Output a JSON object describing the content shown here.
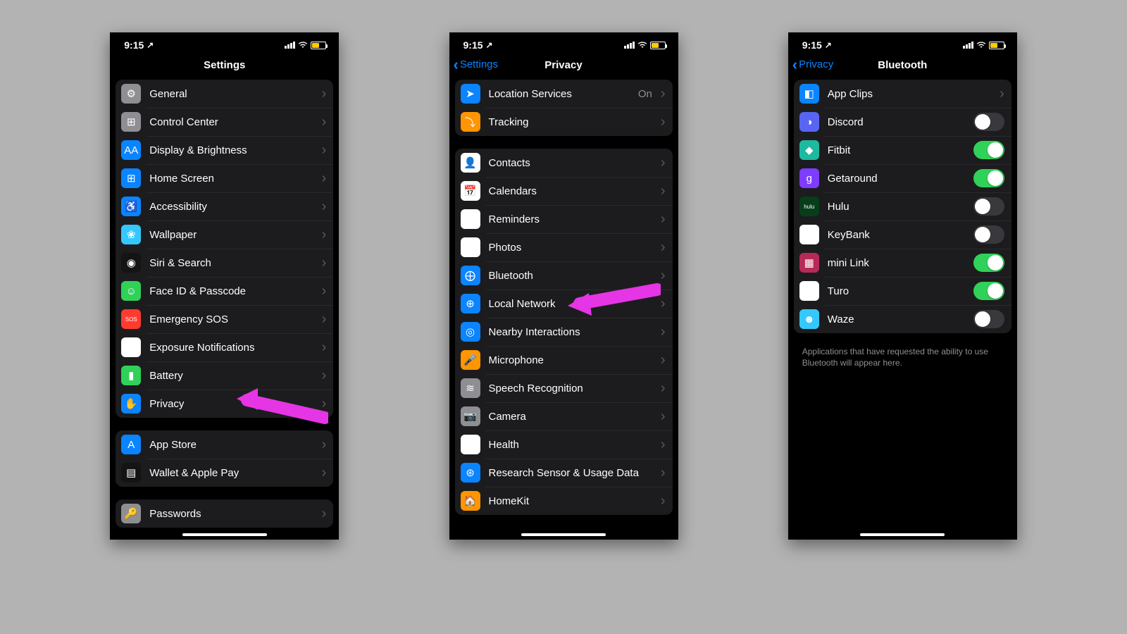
{
  "status": {
    "time": "9:15"
  },
  "screens": {
    "settings": {
      "title": "Settings",
      "g1": [
        {
          "label": "General",
          "icon": "⚙",
          "bg": "bg-gray",
          "name": "row-general"
        },
        {
          "label": "Control Center",
          "icon": "⊞",
          "bg": "bg-gray",
          "name": "row-control-center"
        },
        {
          "label": "Display & Brightness",
          "icon": "AA",
          "bg": "bg-blue",
          "name": "row-display"
        },
        {
          "label": "Home Screen",
          "icon": "⊞",
          "bg": "bg-blue",
          "name": "row-home-screen"
        },
        {
          "label": "Accessibility",
          "icon": "♿",
          "bg": "bg-blue",
          "name": "row-accessibility"
        },
        {
          "label": "Wallpaper",
          "icon": "❀",
          "bg": "bg-cyan",
          "name": "row-wallpaper"
        },
        {
          "label": "Siri & Search",
          "icon": "◉",
          "bg": "bg-dark",
          "name": "row-siri"
        },
        {
          "label": "Face ID & Passcode",
          "icon": "☺",
          "bg": "bg-green",
          "name": "row-faceid"
        },
        {
          "label": "Emergency SOS",
          "icon": "SOS",
          "bg": "bg-red",
          "name": "row-sos"
        },
        {
          "label": "Exposure Notifications",
          "icon": "⊛",
          "bg": "bg-white",
          "name": "row-exposure"
        },
        {
          "label": "Battery",
          "icon": "▮",
          "bg": "bg-green",
          "name": "row-battery"
        },
        {
          "label": "Privacy",
          "icon": "✋",
          "bg": "bg-blue",
          "name": "row-privacy"
        }
      ],
      "g2": [
        {
          "label": "App Store",
          "icon": "A",
          "bg": "bg-blue",
          "name": "row-appstore"
        },
        {
          "label": "Wallet & Apple Pay",
          "icon": "▤",
          "bg": "bg-dark",
          "name": "row-wallet"
        }
      ],
      "g3": [
        {
          "label": "Passwords",
          "icon": "🔑",
          "bg": "bg-gray",
          "name": "row-passwords"
        }
      ]
    },
    "privacy": {
      "title": "Privacy",
      "back": "Settings",
      "g1": [
        {
          "label": "Location Services",
          "icon": "➤",
          "bg": "bg-blue",
          "value": "On",
          "name": "row-location"
        },
        {
          "label": "Tracking",
          "icon": "⤵",
          "bg": "bg-orange",
          "name": "row-tracking"
        }
      ],
      "g2": [
        {
          "label": "Contacts",
          "icon": "👤",
          "bg": "bg-white",
          "name": "row-contacts"
        },
        {
          "label": "Calendars",
          "icon": "📅",
          "bg": "bg-white",
          "name": "row-calendars"
        },
        {
          "label": "Reminders",
          "icon": "•",
          "bg": "bg-white",
          "name": "row-reminders"
        },
        {
          "label": "Photos",
          "icon": "✿",
          "bg": "bg-white",
          "name": "row-photos"
        },
        {
          "label": "Bluetooth",
          "icon": "⨁",
          "bg": "bg-blue",
          "name": "row-bluetooth"
        },
        {
          "label": "Local Network",
          "icon": "⊕",
          "bg": "bg-blue",
          "name": "row-local-network"
        },
        {
          "label": "Nearby Interactions",
          "icon": "◎",
          "bg": "bg-blue",
          "name": "row-nearby"
        },
        {
          "label": "Microphone",
          "icon": "🎤",
          "bg": "bg-orange",
          "name": "row-mic"
        },
        {
          "label": "Speech Recognition",
          "icon": "≋",
          "bg": "bg-gray",
          "name": "row-speech"
        },
        {
          "label": "Camera",
          "icon": "📷",
          "bg": "bg-gray",
          "name": "row-camera"
        },
        {
          "label": "Health",
          "icon": "♥",
          "bg": "bg-white",
          "name": "row-health"
        },
        {
          "label": "Research Sensor & Usage Data",
          "icon": "⊛",
          "bg": "bg-blue",
          "name": "row-research"
        },
        {
          "label": "HomeKit",
          "icon": "🏠",
          "bg": "bg-orange",
          "name": "row-homekit"
        }
      ]
    },
    "bluetooth": {
      "title": "Bluetooth",
      "back": "Privacy",
      "g1": [
        {
          "label": "App Clips",
          "icon": "◧",
          "bg": "bg-blue",
          "name": "row-appclips",
          "type": "nav"
        },
        {
          "label": "Discord",
          "icon": "◑",
          "bg": "bg-indigo",
          "name": "row-discord",
          "type": "toggle",
          "on": false
        },
        {
          "label": "Fitbit",
          "icon": "◆",
          "bg": "bg-teal",
          "name": "row-fitbit",
          "type": "toggle",
          "on": true
        },
        {
          "label": "Getaround",
          "icon": "g",
          "bg": "bg-purple",
          "name": "row-getaround",
          "type": "toggle",
          "on": true
        },
        {
          "label": "Hulu",
          "icon": "hulu",
          "bg": "bg-darkgreen",
          "name": "row-hulu",
          "type": "toggle",
          "on": false
        },
        {
          "label": "KeyBank",
          "icon": "⚿",
          "bg": "bg-white",
          "name": "row-keybank",
          "type": "toggle",
          "on": false
        },
        {
          "label": "mini Link",
          "icon": "▦",
          "bg": "bg-pink",
          "name": "row-minilink",
          "type": "toggle",
          "on": true
        },
        {
          "label": "Turo",
          "icon": "TURO",
          "bg": "bg-white",
          "name": "row-turo",
          "type": "toggle",
          "on": true
        },
        {
          "label": "Waze",
          "icon": "☻",
          "bg": "bg-cyan",
          "name": "row-waze",
          "type": "toggle",
          "on": false
        }
      ],
      "footer": "Applications that have requested the ability to use Bluetooth will appear here."
    }
  }
}
